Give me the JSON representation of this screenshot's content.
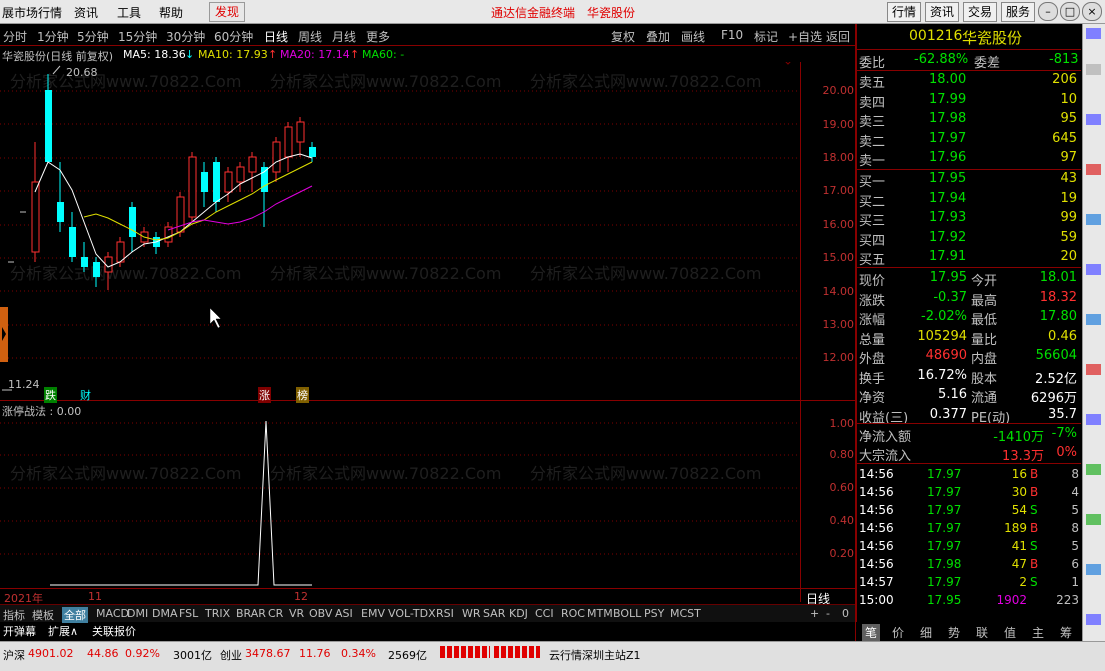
{
  "menu": {
    "items": [
      "展市场行情",
      "资讯",
      "工具",
      "帮助"
    ],
    "discover": "发现",
    "center_title": "通达信金融终端",
    "stock_title": "华瓷股份",
    "buttons": [
      "行情",
      "资讯",
      "交易",
      "服务"
    ]
  },
  "periods": [
    "分时",
    "1分钟",
    "5分钟",
    "15分钟",
    "30分钟",
    "60分钟",
    "日线",
    "周线",
    "月线",
    "更多"
  ],
  "period_active": "日线",
  "toolbar_right": [
    "复权",
    "叠加",
    "画线",
    "F10",
    "标记",
    "+自选",
    "返回"
  ],
  "info": {
    "name": "华瓷股份(日线 前复权)",
    "ma5": "MA5: 18.36",
    "ma5_arrow": "↓",
    "ma10": "MA10: 17.93",
    "ma10_arrow": "↑",
    "ma20": "MA20: 17.14",
    "ma20_arrow": "↑",
    "ma60": "MA60: -"
  },
  "price_axis": [
    "20.00",
    "19.00",
    "18.00",
    "17.00",
    "16.00",
    "15.00",
    "14.00",
    "13.00",
    "12.00"
  ],
  "high_mark": "20.68",
  "low_mark": "11.24",
  "events": {
    "a": "跌",
    "b": "财",
    "c": "涨",
    "d": "榜"
  },
  "indicator": {
    "title": "涨停战法 : 0.00",
    "axis": [
      "1.00",
      "0.80",
      "0.60",
      "0.40",
      "0.20"
    ]
  },
  "date_axis": {
    "year": "2021年",
    "m11": "11",
    "m12": "12",
    "period_label": "日线",
    "controls": [
      "+",
      "-",
      "0"
    ]
  },
  "watermark": "分析家公式网www.70822.Com",
  "bottom_tabs": [
    "指标",
    "模板",
    "全部",
    "MACD",
    "DMI",
    "DMA",
    "FSL",
    "TRIX",
    "BRAR",
    "CR",
    "VR",
    "OBV",
    "ASI",
    "EMV",
    "VOL-TDX",
    "RSI",
    "WR",
    "SAR",
    "KDJ",
    "CCI",
    "ROC",
    "MTM",
    "BOLL",
    "PSY",
    "MCST"
  ],
  "bottom_tab_active": "全部",
  "bottom_row2": [
    "开弹幕",
    "扩展∧",
    "关联报价"
  ],
  "status": {
    "sh_label": "沪深",
    "sh_val": "4901.02",
    "sh_chg": "44.86",
    "sh_pct": "0.92%",
    "sh_amt": "3001亿",
    "cy_label": "创业",
    "cy_val": "3478.67",
    "cy_chg": "11.76",
    "cy_pct": "0.34%",
    "cy_amt": "2569亿",
    "server": "云行情深圳主站Z1"
  },
  "quote": {
    "code": "001216",
    "name": "华瓷股份",
    "weibi_label": "委比",
    "weibi": "-62.88%",
    "weicha_label": "委差",
    "weicha": "-813",
    "asks": [
      [
        "卖五",
        "18.00",
        "206"
      ],
      [
        "卖四",
        "17.99",
        "10"
      ],
      [
        "卖三",
        "17.98",
        "95"
      ],
      [
        "卖二",
        "17.97",
        "645"
      ],
      [
        "卖一",
        "17.96",
        "97"
      ]
    ],
    "bids": [
      [
        "买一",
        "17.95",
        "43"
      ],
      [
        "买二",
        "17.94",
        "19"
      ],
      [
        "买三",
        "17.93",
        "99"
      ],
      [
        "买四",
        "17.92",
        "59"
      ],
      [
        "买五",
        "17.91",
        "20"
      ]
    ],
    "stats": [
      [
        "现价",
        "17.95",
        "今开",
        "18.01"
      ],
      [
        "涨跌",
        "-0.37",
        "最高",
        "18.32"
      ],
      [
        "涨幅",
        "-2.02%",
        "最低",
        "17.80"
      ],
      [
        "总量",
        "105294",
        "量比",
        "0.46"
      ],
      [
        "外盘",
        "48690",
        "内盘",
        "56604"
      ],
      [
        "换手",
        "16.72%",
        "股本",
        "2.52亿"
      ],
      [
        "净资",
        "5.16",
        "流通",
        "6296万"
      ],
      [
        "收益(三)",
        "0.377",
        "PE(动)",
        "35.7"
      ]
    ],
    "flow": [
      [
        "净流入额",
        "-1410万",
        "-7%"
      ],
      [
        "大宗流入",
        "13.3万",
        "0%"
      ]
    ],
    "ticks": [
      [
        "14:56",
        "17.97",
        "16",
        "B",
        "8"
      ],
      [
        "14:56",
        "17.97",
        "30",
        "B",
        "4"
      ],
      [
        "14:56",
        "17.97",
        "54",
        "S",
        "5"
      ],
      [
        "14:56",
        "17.97",
        "189",
        "B",
        "8"
      ],
      [
        "14:56",
        "17.97",
        "41",
        "S",
        "5"
      ],
      [
        "14:56",
        "17.98",
        "47",
        "B",
        "6"
      ],
      [
        "14:57",
        "17.97",
        "2",
        "S",
        "1"
      ],
      [
        "15:00",
        "17.95",
        "1902",
        "",
        "223"
      ]
    ]
  },
  "right_tabs": [
    "笔",
    "价",
    "细",
    "势",
    "联",
    "值",
    "主",
    "筹"
  ],
  "right_tab_active": "笔",
  "colors": {
    "up": "#ff3030",
    "down": "#00ffff",
    "ma5": "#ffffff",
    "ma10": "#e0e000",
    "ma20": "#e000e0",
    "grid": "#800000"
  }
}
